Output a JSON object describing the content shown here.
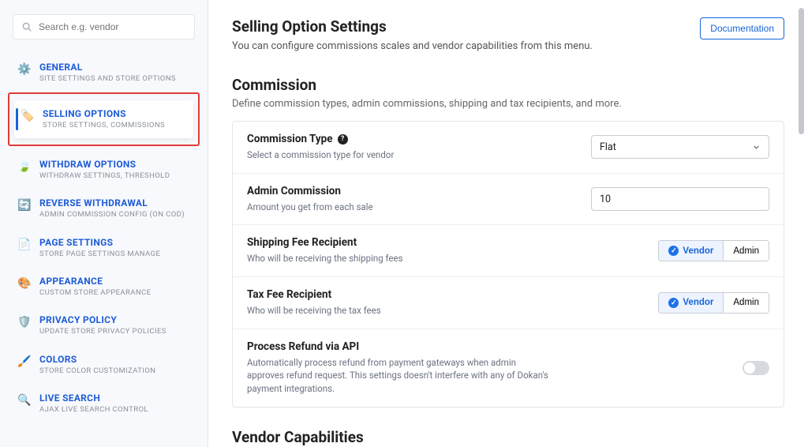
{
  "search": {
    "placeholder": "Search e.g. vendor"
  },
  "sidebar": {
    "items": [
      {
        "title": "GENERAL",
        "sub": "SITE SETTINGS AND STORE OPTIONS"
      },
      {
        "title": "SELLING OPTIONS",
        "sub": "STORE SETTINGS, COMMISSIONS"
      },
      {
        "title": "WITHDRAW OPTIONS",
        "sub": "WITHDRAW SETTINGS, THRESHOLD"
      },
      {
        "title": "REVERSE WITHDRAWAL",
        "sub": "ADMIN COMMISSION CONFIG (ON COD)"
      },
      {
        "title": "PAGE SETTINGS",
        "sub": "STORE PAGE SETTINGS MANAGE"
      },
      {
        "title": "APPEARANCE",
        "sub": "CUSTOM STORE APPEARANCE"
      },
      {
        "title": "PRIVACY POLICY",
        "sub": "UPDATE STORE PRIVACY POLICIES"
      },
      {
        "title": "COLORS",
        "sub": "STORE COLOR CUSTOMIZATION"
      },
      {
        "title": "LIVE SEARCH",
        "sub": "AJAX LIVE SEARCH CONTROL"
      }
    ]
  },
  "header": {
    "title": "Selling Option Settings",
    "desc": "You can configure commissions scales and vendor capabilities from this menu.",
    "doc_btn": "Documentation"
  },
  "commission": {
    "title": "Commission",
    "desc": "Define commission types, admin commissions, shipping and tax recipients, and more.",
    "rows": {
      "type": {
        "title": "Commission Type",
        "desc": "Select a commission type for vendor",
        "value": "Flat"
      },
      "admin": {
        "title": "Admin Commission",
        "desc": "Amount you get from each sale",
        "value": "10"
      },
      "shipping": {
        "title": "Shipping Fee Recipient",
        "desc": "Who will be receiving the shipping fees",
        "opt_vendor": "Vendor",
        "opt_admin": "Admin"
      },
      "tax": {
        "title": "Tax Fee Recipient",
        "desc": "Who will be receiving the tax fees",
        "opt_vendor": "Vendor",
        "opt_admin": "Admin"
      },
      "refund": {
        "title": "Process Refund via API",
        "desc": "Automatically process refund from payment gateways when admin approves refund request. This settings doesn't interfere with any of Dokan's payment integrations."
      }
    }
  },
  "vendor_cap": {
    "title": "Vendor Capabilities"
  }
}
